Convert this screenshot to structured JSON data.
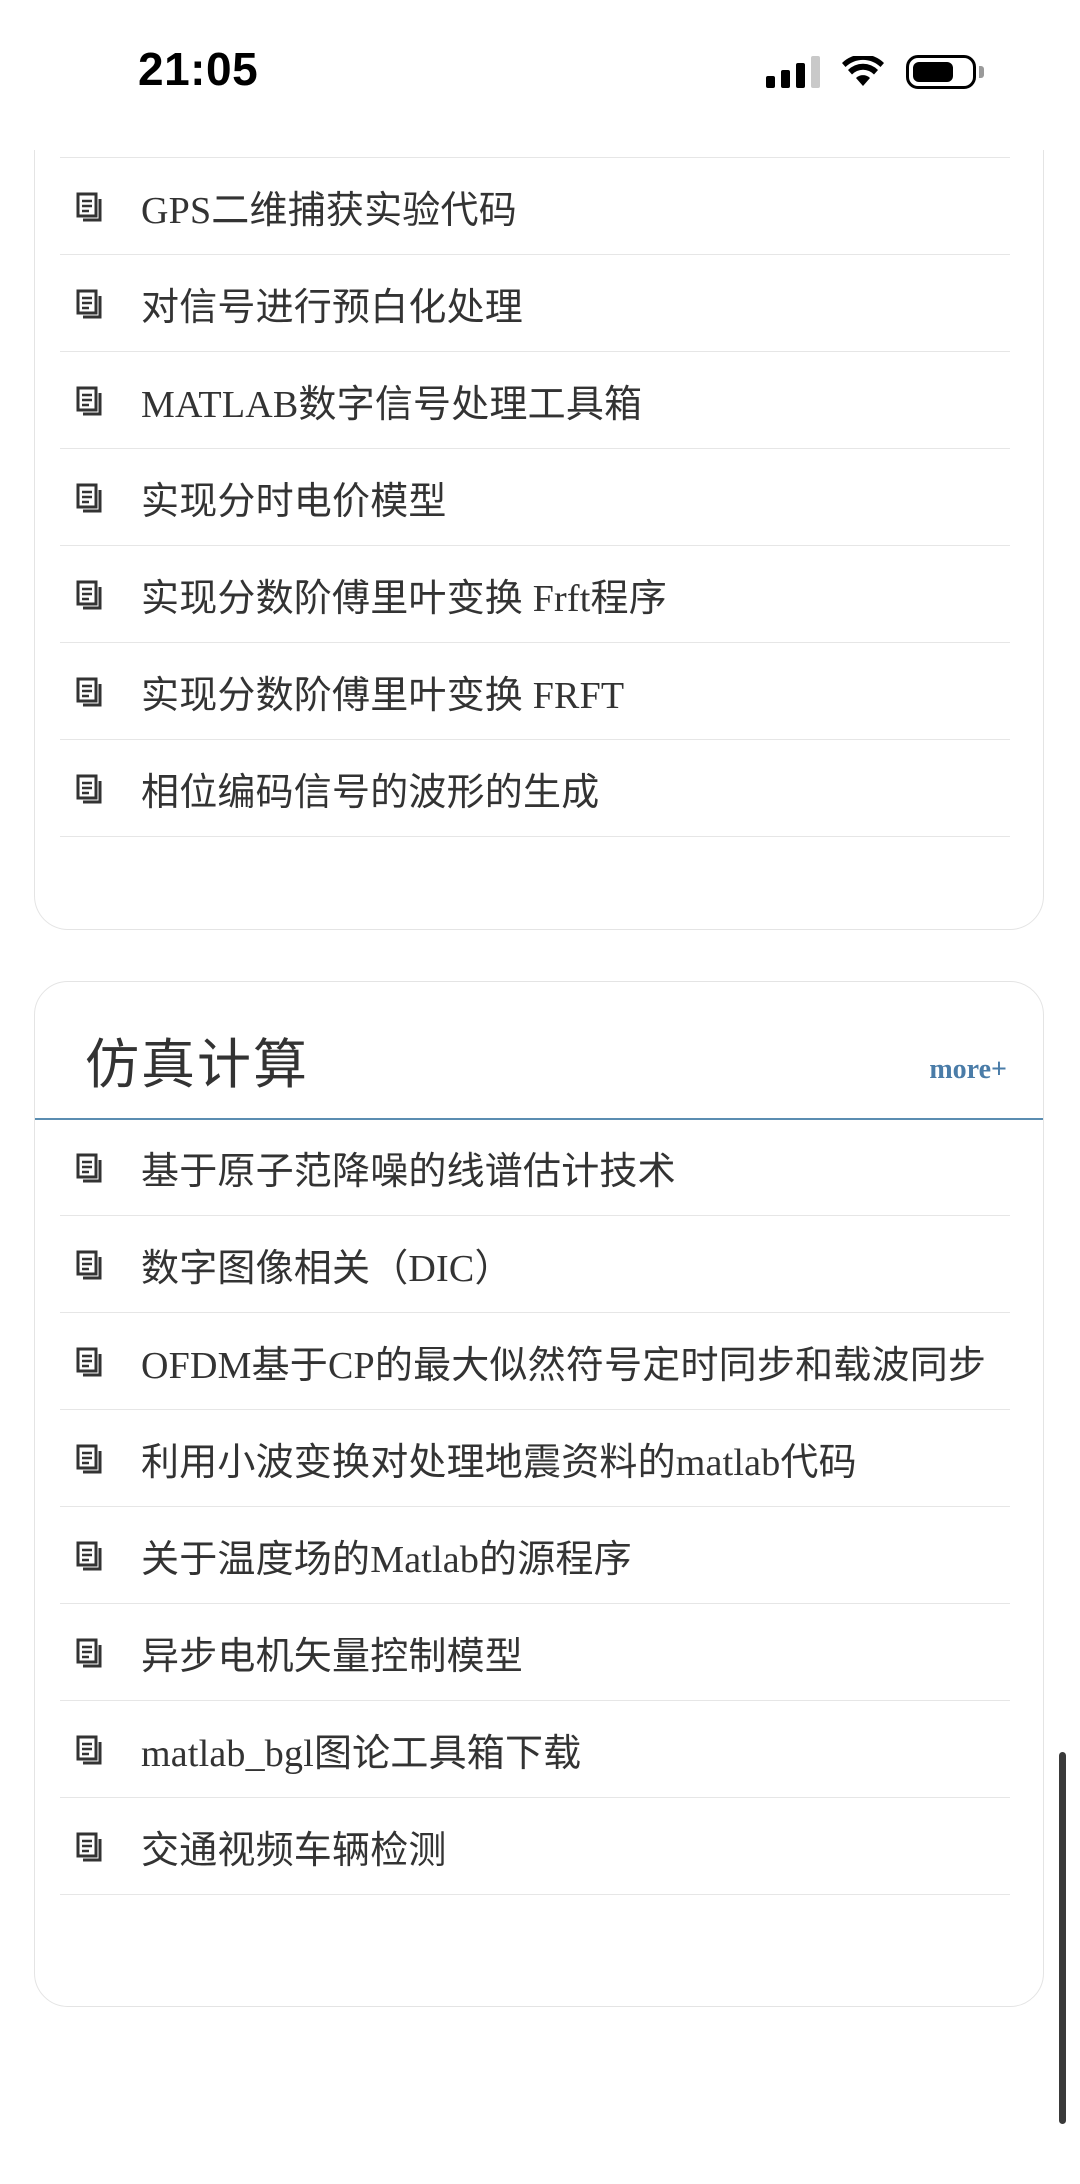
{
  "status_bar": {
    "time": "21:05"
  },
  "top_section": {
    "items": [
      {
        "label": "GPS二维捕获实验代码"
      },
      {
        "label": "对信号进行预白化处理"
      },
      {
        "label": "MATLAB数字信号处理工具箱"
      },
      {
        "label": "实现分时电价模型"
      },
      {
        "label": "实现分数阶傅里叶变换 Frft程序"
      },
      {
        "label": "实现分数阶傅里叶变换 FRFT"
      },
      {
        "label": "相位编码信号的波形的生成"
      }
    ]
  },
  "simulation_section": {
    "title": "仿真计算",
    "more_label": "more+",
    "items": [
      {
        "label": "基于原子范降噪的线谱估计技术"
      },
      {
        "label": "数字图像相关（DIC）"
      },
      {
        "label": "OFDM基于CP的最大似然符号定时同步和载波同步"
      },
      {
        "label": "利用小波变换对处理地震资料的matlab代码"
      },
      {
        "label": "关于温度场的Matlab的源程序"
      },
      {
        "label": "异步电机矢量控制模型"
      },
      {
        "label": "matlab_bgl图论工具箱下载"
      },
      {
        "label": "交通视频车辆检测"
      }
    ]
  },
  "colors": {
    "accent": "#4a7ca8",
    "rule": "#5b8db1",
    "text": "#333333",
    "border": "#e4e4e4"
  },
  "icons": {
    "item_icon": "document-list-icon"
  }
}
